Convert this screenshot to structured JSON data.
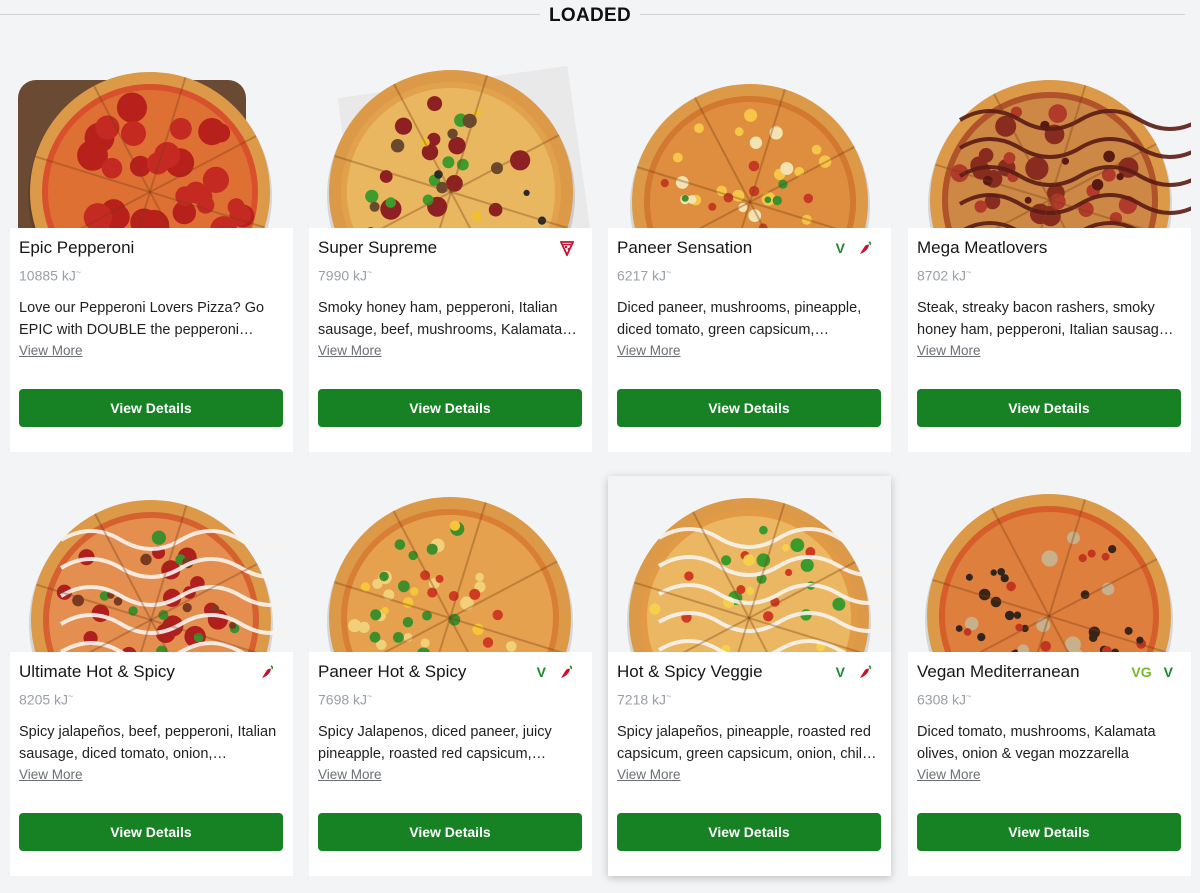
{
  "section": {
    "title": "LOADED"
  },
  "colors": {
    "button": "#168224",
    "veg": "#1b8a2e",
    "vegan": "#77b82a",
    "spicy": "#c8102e"
  },
  "products": [
    {
      "name": "Epic Pepperoni",
      "energy": "10885 kJ",
      "energy_mark": "~",
      "description": "Love our Pepperoni Lovers Pizza? Go EPIC with DOUBLE the pepperoni and…",
      "more_label": "View More",
      "button_label": "View Details",
      "badges": [],
      "topping": "pepperoni"
    },
    {
      "name": "Super Supreme",
      "energy": "7990 kJ",
      "energy_mark": "~",
      "description": "Smoky honey ham, pepperoni, Italian sausage, beef, mushrooms, Kalamata…",
      "more_label": "View More",
      "button_label": "View Details",
      "badges": [
        "pizza-slice-icon"
      ],
      "topping": "supreme"
    },
    {
      "name": "Paneer Sensation",
      "energy": "6217 kJ",
      "energy_mark": "~",
      "description": "Diced paneer, mushrooms, pineapple, diced tomato, green capsicum,…",
      "more_label": "View More",
      "button_label": "View Details",
      "badges": [
        "V",
        "chilli-icon"
      ],
      "topping": "paneer"
    },
    {
      "name": "Mega Meatlovers",
      "energy": "8702 kJ",
      "energy_mark": "~",
      "description": "Steak, streaky bacon rashers, smoky honey ham, pepperoni, Italian sausag…",
      "more_label": "View More",
      "button_label": "View Details",
      "badges": [],
      "topping": "meat"
    },
    {
      "name": "Ultimate Hot & Spicy",
      "energy": "8205 kJ",
      "energy_mark": "~",
      "description": "Spicy jalapeños, beef, pepperoni, Italian sausage, diced tomato, onion,…",
      "more_label": "View More",
      "button_label": "View Details",
      "badges": [
        "chilli-icon"
      ],
      "topping": "hotspicy"
    },
    {
      "name": "Paneer Hot & Spicy",
      "energy": "7698 kJ",
      "energy_mark": "~",
      "description": "Spicy Jalapenos, diced paneer, juicy pineapple, roasted red capsicum,…",
      "more_label": "View More",
      "button_label": "View Details",
      "badges": [
        "V",
        "chilli-icon"
      ],
      "topping": "paneerhot"
    },
    {
      "name": "Hot & Spicy Veggie",
      "energy": "7218 kJ",
      "energy_mark": "~",
      "description": "Spicy jalapeños, pineapple, roasted red capsicum, green capsicum, onion, chil…",
      "more_label": "View More",
      "button_label": "View Details",
      "badges": [
        "V",
        "chilli-icon"
      ],
      "topping": "veggie"
    },
    {
      "name": "Vegan Mediterranean",
      "energy": "6308 kJ",
      "energy_mark": "~",
      "description": "Diced tomato, mushrooms, Kalamata olives, onion & vegan mozzarella",
      "more_label": "View More",
      "button_label": "View Details",
      "badges": [
        "VG",
        "V"
      ],
      "topping": "vegan"
    }
  ]
}
